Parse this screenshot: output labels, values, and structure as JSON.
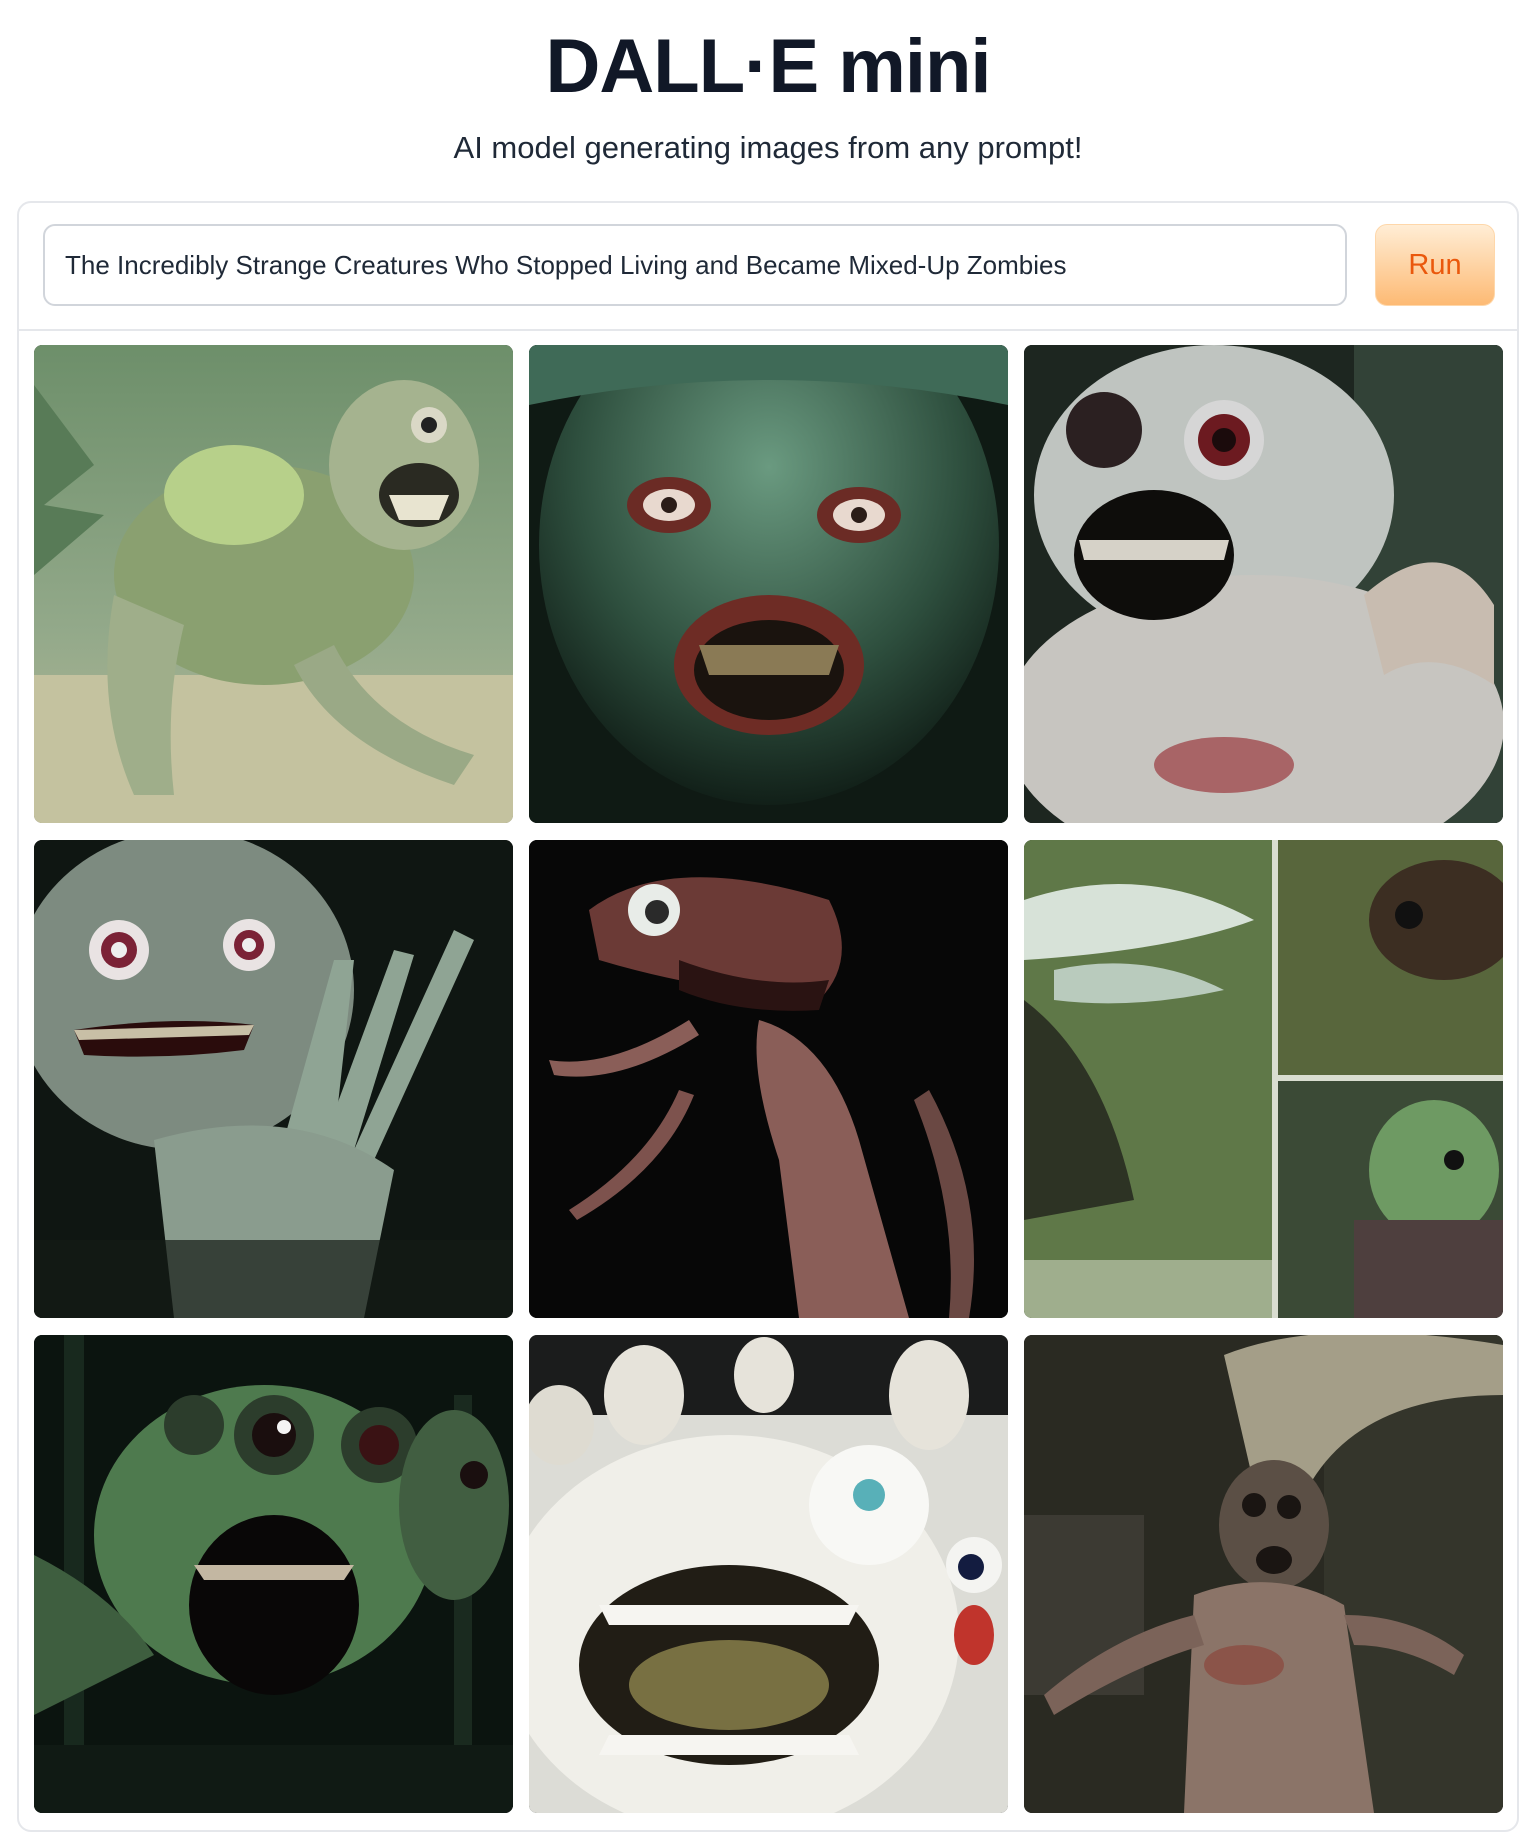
{
  "header": {
    "title": "DALL·E mini",
    "subtitle": "AI model generating images from any prompt!"
  },
  "prompt": {
    "value": "The Incredibly Strange Creatures Who Stopped Living and Became Mixed-Up Zombies",
    "run_label": "Run"
  },
  "gallery": {
    "images": [
      {
        "name": "green crouching creature on beach"
      },
      {
        "name": "green zombie face close-up"
      },
      {
        "name": "pale creature with red eye"
      },
      {
        "name": "green creature with waving hand"
      },
      {
        "name": "red long-necked creature"
      },
      {
        "name": "green collage of creatures"
      },
      {
        "name": "green multi-eyed creature"
      },
      {
        "name": "pale creatures with open mouths"
      },
      {
        "name": "hairy figure in dark room"
      }
    ]
  }
}
